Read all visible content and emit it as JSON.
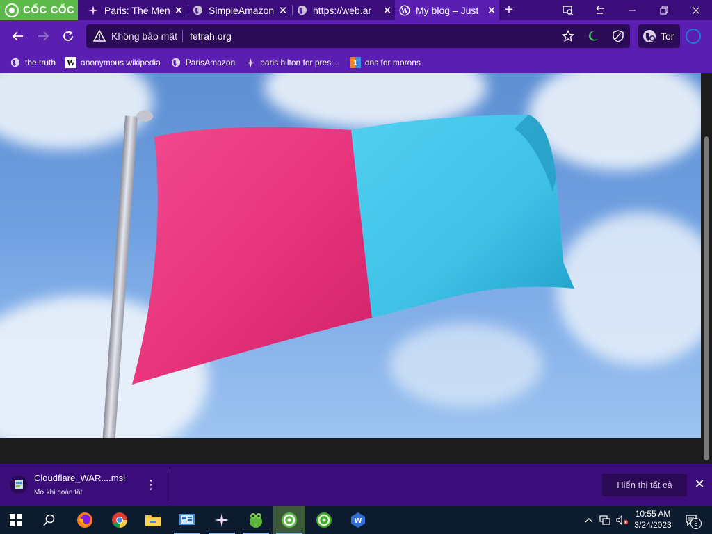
{
  "browser": {
    "brand": "CỐC CỐC",
    "tabs": [
      {
        "title": "Paris: The Men",
        "icon": "sparkle-icon"
      },
      {
        "title": "SimpleAmazon",
        "icon": "globe-icon"
      },
      {
        "title": "https://web.ar",
        "icon": "globe-icon"
      },
      {
        "title": "My blog – Just",
        "icon": "wordpress-icon",
        "active": true
      }
    ],
    "new_tab": "+"
  },
  "toolbar": {
    "security_label": "Không bảo mật",
    "url": "fetrah.org",
    "tor_label": "Tor"
  },
  "bookmarks": [
    {
      "label": "the truth",
      "icon": "globe-icon"
    },
    {
      "label": "anonymous wikipedia",
      "icon": "wikipedia-icon"
    },
    {
      "label": "ParisAmazon",
      "icon": "globe-icon"
    },
    {
      "label": "paris hilton for presi...",
      "icon": "sparkle-icon"
    },
    {
      "label": "dns for morons",
      "icon": "cloudflare-dns-icon"
    }
  ],
  "content": {
    "image": "pink-and-cyan-flag",
    "flag_colors": {
      "left": "#e8357d",
      "right": "#3ec1e6",
      "sky": "#6f9fe0"
    }
  },
  "download": {
    "filename": "Cloudflare_WAR....msi",
    "status": "Mở khi hoàn tất",
    "show_all": "Hiển thị tất cả"
  },
  "taskbar": {
    "apps": [
      "windows-start-icon",
      "search-icon",
      "firefox-icon",
      "chrome-icon",
      "file-explorer-icon",
      "control-panel-icon",
      "sparkle-app-icon",
      "frog-app-icon",
      "coccoc-icon",
      "coccoc-green-icon",
      "wps-icon"
    ],
    "time": "10:55 AM",
    "date": "3/24/2023",
    "notification_count": "5"
  }
}
